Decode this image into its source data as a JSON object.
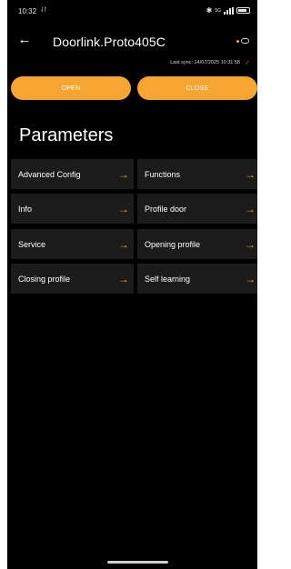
{
  "status_bar": {
    "time": "10:32",
    "upload_glyph": "⥯",
    "bluetooth_glyph": "✱",
    "network_label": "5G"
  },
  "header": {
    "back_glyph": "←",
    "title": "Doorlink.Proto405C",
    "last_sync": "Last sync: 14/07/2025 10:31:58",
    "sync_check_glyph": "✓"
  },
  "actions": {
    "open_label": "OPEN",
    "close_label": "CLOSE"
  },
  "parameters": {
    "title": "Parameters",
    "arrow_glyph": "→",
    "items": [
      {
        "label": "Advanced Config"
      },
      {
        "label": "Functions"
      },
      {
        "label": "Info"
      },
      {
        "label": "Profile door"
      },
      {
        "label": "Service"
      },
      {
        "label": "Opening profile"
      },
      {
        "label": "Closing profile"
      },
      {
        "label": "Self learning"
      }
    ]
  },
  "colors": {
    "accent": "#f6a533",
    "background": "#000000",
    "card": "#1b1b1b"
  }
}
